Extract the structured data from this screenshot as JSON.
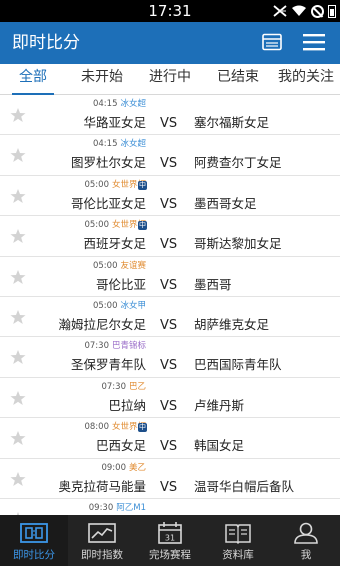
{
  "status_bar": {
    "time": "17:31"
  },
  "app_bar": {
    "title": "即时比分"
  },
  "tabs": [
    {
      "label": "全部",
      "active": true
    },
    {
      "label": "未开始",
      "active": false
    },
    {
      "label": "进行中",
      "active": false
    },
    {
      "label": "已结束",
      "active": false
    },
    {
      "label": "我的关注",
      "active": false
    }
  ],
  "matches": [
    {
      "time": "04:15",
      "league": "冰女超",
      "league_color": "#3d8fd6",
      "home": "华路亚女足",
      "vs": "VS",
      "away": "塞尔福斯女足"
    },
    {
      "time": "04:15",
      "league": "冰女超",
      "league_color": "#3d8fd6",
      "home": "图罗杜尔女足",
      "vs": "VS",
      "away": "阿费查尔丁女足"
    },
    {
      "time": "05:00",
      "league": "女世界杯",
      "league_color": "#e08a2e",
      "badge": "中",
      "home": "哥伦比亚女足",
      "vs": "VS",
      "away": "墨西哥女足"
    },
    {
      "time": "05:00",
      "league": "女世界杯",
      "league_color": "#e08a2e",
      "badge": "中",
      "home": "西班牙女足",
      "vs": "VS",
      "away": "哥斯达黎加女足"
    },
    {
      "time": "05:00",
      "league": "友谊赛",
      "league_color": "#e08a2e",
      "home": "哥伦比亚",
      "vs": "VS",
      "away": "墨西哥"
    },
    {
      "time": "05:00",
      "league": "冰女甲",
      "league_color": "#3d8fd6",
      "home": "瀚姆拉尼尔女足",
      "vs": "VS",
      "away": "胡萨维克女足"
    },
    {
      "time": "07:30",
      "league": "巴青锦标",
      "league_color": "#9b6fc9",
      "home": "圣保罗青年队",
      "vs": "VS",
      "away": "巴西国际青年队"
    },
    {
      "time": "07:30",
      "league": "巴乙",
      "league_color": "#e08a2e",
      "home": "巴拉纳",
      "vs": "VS",
      "away": "卢维丹斯"
    },
    {
      "time": "08:00",
      "league": "女世界杯",
      "league_color": "#e08a2e",
      "badge": "中",
      "home": "巴西女足",
      "vs": "VS",
      "away": "韩国女足"
    },
    {
      "time": "09:00",
      "league": "美乙",
      "league_color": "#e08a2e",
      "home": "奥克拉荷马能量",
      "vs": "VS",
      "away": "温哥华白帽后备队"
    },
    {
      "time": "09:30",
      "league": "阿乙M1",
      "league_color": "#3d8fd6",
      "home": "",
      "vs": "",
      "away": ""
    }
  ],
  "bottom_nav": [
    {
      "label": "即时比分",
      "icon": "live-score-icon",
      "active": true
    },
    {
      "label": "即时指数",
      "icon": "chart-icon",
      "active": false
    },
    {
      "label": "完场赛程",
      "icon": "calendar-icon",
      "active": false
    },
    {
      "label": "资料库",
      "icon": "book-icon",
      "active": false
    },
    {
      "label": "我",
      "icon": "user-icon",
      "active": false
    }
  ],
  "colors": {
    "accent": "#1d6fb8",
    "nav_active": "#3c96e8",
    "nav_bg": "#232323"
  }
}
